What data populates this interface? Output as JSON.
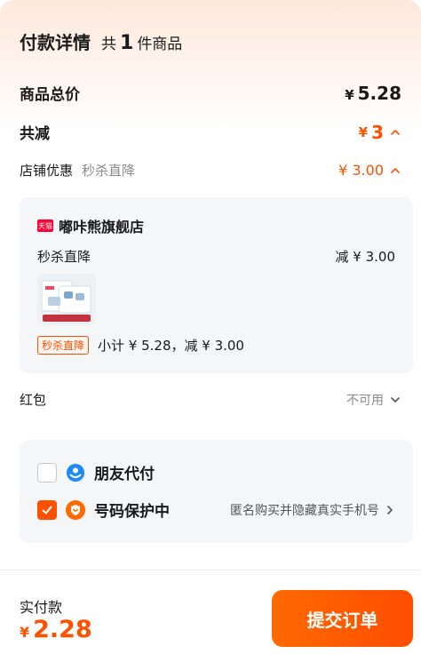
{
  "header": {
    "title": "付款详情",
    "count_prefix": "共",
    "count": "1",
    "count_suffix": "件商品"
  },
  "total": {
    "label": "商品总价",
    "currency": "¥",
    "amount": "5.28"
  },
  "reduce": {
    "label": "共减",
    "currency": "¥",
    "amount": "3"
  },
  "shop_discount": {
    "label": "店铺优惠",
    "sub": "秒杀直降",
    "value": "¥ 3.00"
  },
  "shop_card": {
    "badge": "天猫",
    "shop_name": "嘟咔熊旗舰店",
    "promo_name": "秒杀直降",
    "promo_amount": "减 ¥ 3.00",
    "tag": "秒杀直降",
    "subtotal": "小计 ¥ 5.28，减 ¥ 3.00"
  },
  "hongbao": {
    "label": "红包",
    "value": "不可用"
  },
  "options": {
    "friend_pay": {
      "label": "朋友代付",
      "checked": false
    },
    "number_protect": {
      "label": "号码保护中",
      "desc": "匿名购买并隐藏真实手机号",
      "checked": true
    }
  },
  "footer": {
    "pay_label": "实付款",
    "currency": "¥",
    "amount": "2.28",
    "submit_label": "提交订单"
  },
  "colors": {
    "accent": "#ff5000",
    "tmall_red": "#ff0036",
    "friend_blue": "#1e8bf0"
  }
}
